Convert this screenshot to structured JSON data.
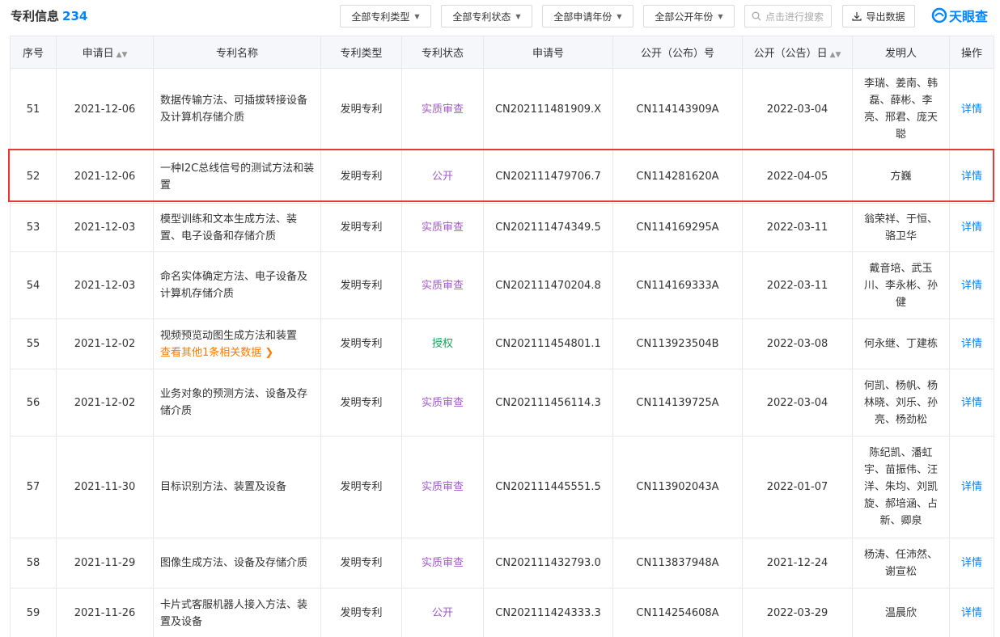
{
  "header": {
    "title": "专利信息",
    "count": "234",
    "filters": [
      "全部专利类型",
      "全部专利状态",
      "全部申请年份",
      "全部公开年份"
    ],
    "search_placeholder": "点击进行搜索",
    "export_label": "导出数据",
    "logo_text": "天眼查"
  },
  "table": {
    "columns": [
      "序号",
      "申请日",
      "专利名称",
      "专利类型",
      "专利状态",
      "申请号",
      "公开（公布）号",
      "公开（公告）日",
      "发明人",
      "操作"
    ],
    "rows": [
      {
        "no": "51",
        "date": "2021-12-06",
        "name": "数据传输方法、可插拔转接设备及计算机存储介质",
        "type": "发明专利",
        "status": "实质审查",
        "app_no": "CN202111481909.X",
        "pub_no": "CN114143909A",
        "pub_date": "2022-03-04",
        "inventors": "李瑞、姜南、韩磊、薛彬、李亮、邢君、庞天聪",
        "action": "详情"
      },
      {
        "no": "52",
        "date": "2021-12-06",
        "name": "一种I2C总线信号的测试方法和装置",
        "type": "发明专利",
        "status": "公开",
        "app_no": "CN202111479706.7",
        "pub_no": "CN114281620A",
        "pub_date": "2022-04-05",
        "inventors": "方巍",
        "action": "详情"
      },
      {
        "no": "53",
        "date": "2021-12-03",
        "name": "模型训练和文本生成方法、装置、电子设备和存储介质",
        "type": "发明专利",
        "status": "实质审查",
        "app_no": "CN202111474349.5",
        "pub_no": "CN114169295A",
        "pub_date": "2022-03-11",
        "inventors": "翁荣祥、于恒、骆卫华",
        "action": "详情"
      },
      {
        "no": "54",
        "date": "2021-12-03",
        "name": "命名实体确定方法、电子设备及计算机存储介质",
        "type": "发明专利",
        "status": "实质审查",
        "app_no": "CN202111470204.8",
        "pub_no": "CN114169333A",
        "pub_date": "2022-03-11",
        "inventors": "戴音培、武玉川、李永彬、孙健",
        "action": "详情"
      },
      {
        "no": "55",
        "date": "2021-12-02",
        "name": "视频预览动图生成方法和装置",
        "related": "查看其他1条相关数据 ❯",
        "type": "发明专利",
        "status": "授权",
        "app_no": "CN202111454801.1",
        "pub_no": "CN113923504B",
        "pub_date": "2022-03-08",
        "inventors": "何永继、丁建栋",
        "action": "详情"
      },
      {
        "no": "56",
        "date": "2021-12-02",
        "name": "业务对象的预测方法、设备及存储介质",
        "type": "发明专利",
        "status": "实质审查",
        "app_no": "CN202111456114.3",
        "pub_no": "CN114139725A",
        "pub_date": "2022-03-04",
        "inventors": "何凯、杨帆、杨林晓、刘乐、孙亮、杨劲松",
        "action": "详情"
      },
      {
        "no": "57",
        "date": "2021-11-30",
        "name": "目标识别方法、装置及设备",
        "type": "发明专利",
        "status": "实质审查",
        "app_no": "CN202111445551.5",
        "pub_no": "CN113902043A",
        "pub_date": "2022-01-07",
        "inventors": "陈纪凯、潘虹宇、苗振伟、汪洋、朱均、刘凯旋、郝培涵、占新、卿泉",
        "action": "详情"
      },
      {
        "no": "58",
        "date": "2021-11-29",
        "name": "图像生成方法、设备及存储介质",
        "type": "发明专利",
        "status": "实质审查",
        "app_no": "CN202111432793.0",
        "pub_no": "CN113837948A",
        "pub_date": "2021-12-24",
        "inventors": "杨涛、任沛然、谢宣松",
        "action": "详情"
      },
      {
        "no": "59",
        "date": "2021-11-26",
        "name": "卡片式客服机器人接入方法、装置及设备",
        "type": "发明专利",
        "status": "公开",
        "app_no": "CN202111424333.3",
        "pub_no": "CN114254608A",
        "pub_date": "2022-03-29",
        "inventors": "温晨欣",
        "action": "详情"
      }
    ]
  },
  "colors": {
    "accent": "#0084ff",
    "status_exam": "#a05ac6",
    "status_grant": "#1aa35c",
    "related_link": "#ff7a00",
    "highlight_border": "#e53935"
  }
}
